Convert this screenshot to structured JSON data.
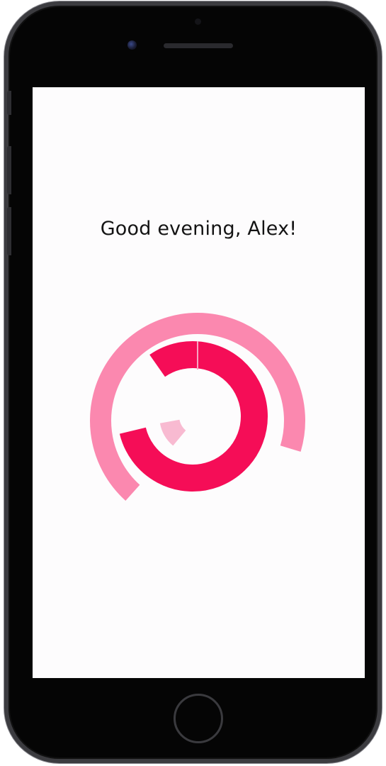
{
  "greeting": {
    "text": "Good evening, Alex!"
  },
  "activity_rings": {
    "rings": [
      {
        "name": "outer-ring",
        "progress": 0.68,
        "color": "#fb88af"
      },
      {
        "name": "middle-ring",
        "progress": 0.81,
        "color": "#f50d57"
      },
      {
        "name": "inner-ring",
        "progress": 0.11,
        "color": "#f8bad1"
      }
    ],
    "marker_color": "#f7a5c2"
  },
  "colors": {
    "background": "#fdfcfd",
    "text": "#141414",
    "device_frame": "#050505"
  },
  "icons": {
    "camera": "front-camera-icon",
    "home": "home-button-icon"
  }
}
